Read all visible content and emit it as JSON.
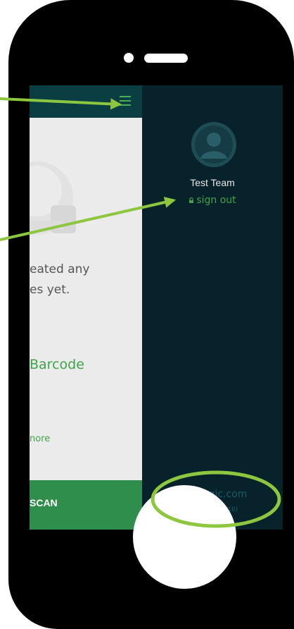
{
  "app": {
    "empty_line1": "eated any",
    "empty_line2": "es yet.",
    "barcode_link": "Barcode",
    "more_link": "nore",
    "scan_label": "SCAN"
  },
  "drawer": {
    "user_name": "Test Team",
    "signout_label": "sign out",
    "site": "autologic.com",
    "version": "1.4.4 Build(316)"
  },
  "colors": {
    "drawer_bg": "#07222a",
    "accent_green": "#3ea447",
    "header_teal": "#0a3e43",
    "annotation_green": "#8dc63f"
  },
  "icons": [
    "menu-icon",
    "user-avatar-icon",
    "lock-icon"
  ]
}
